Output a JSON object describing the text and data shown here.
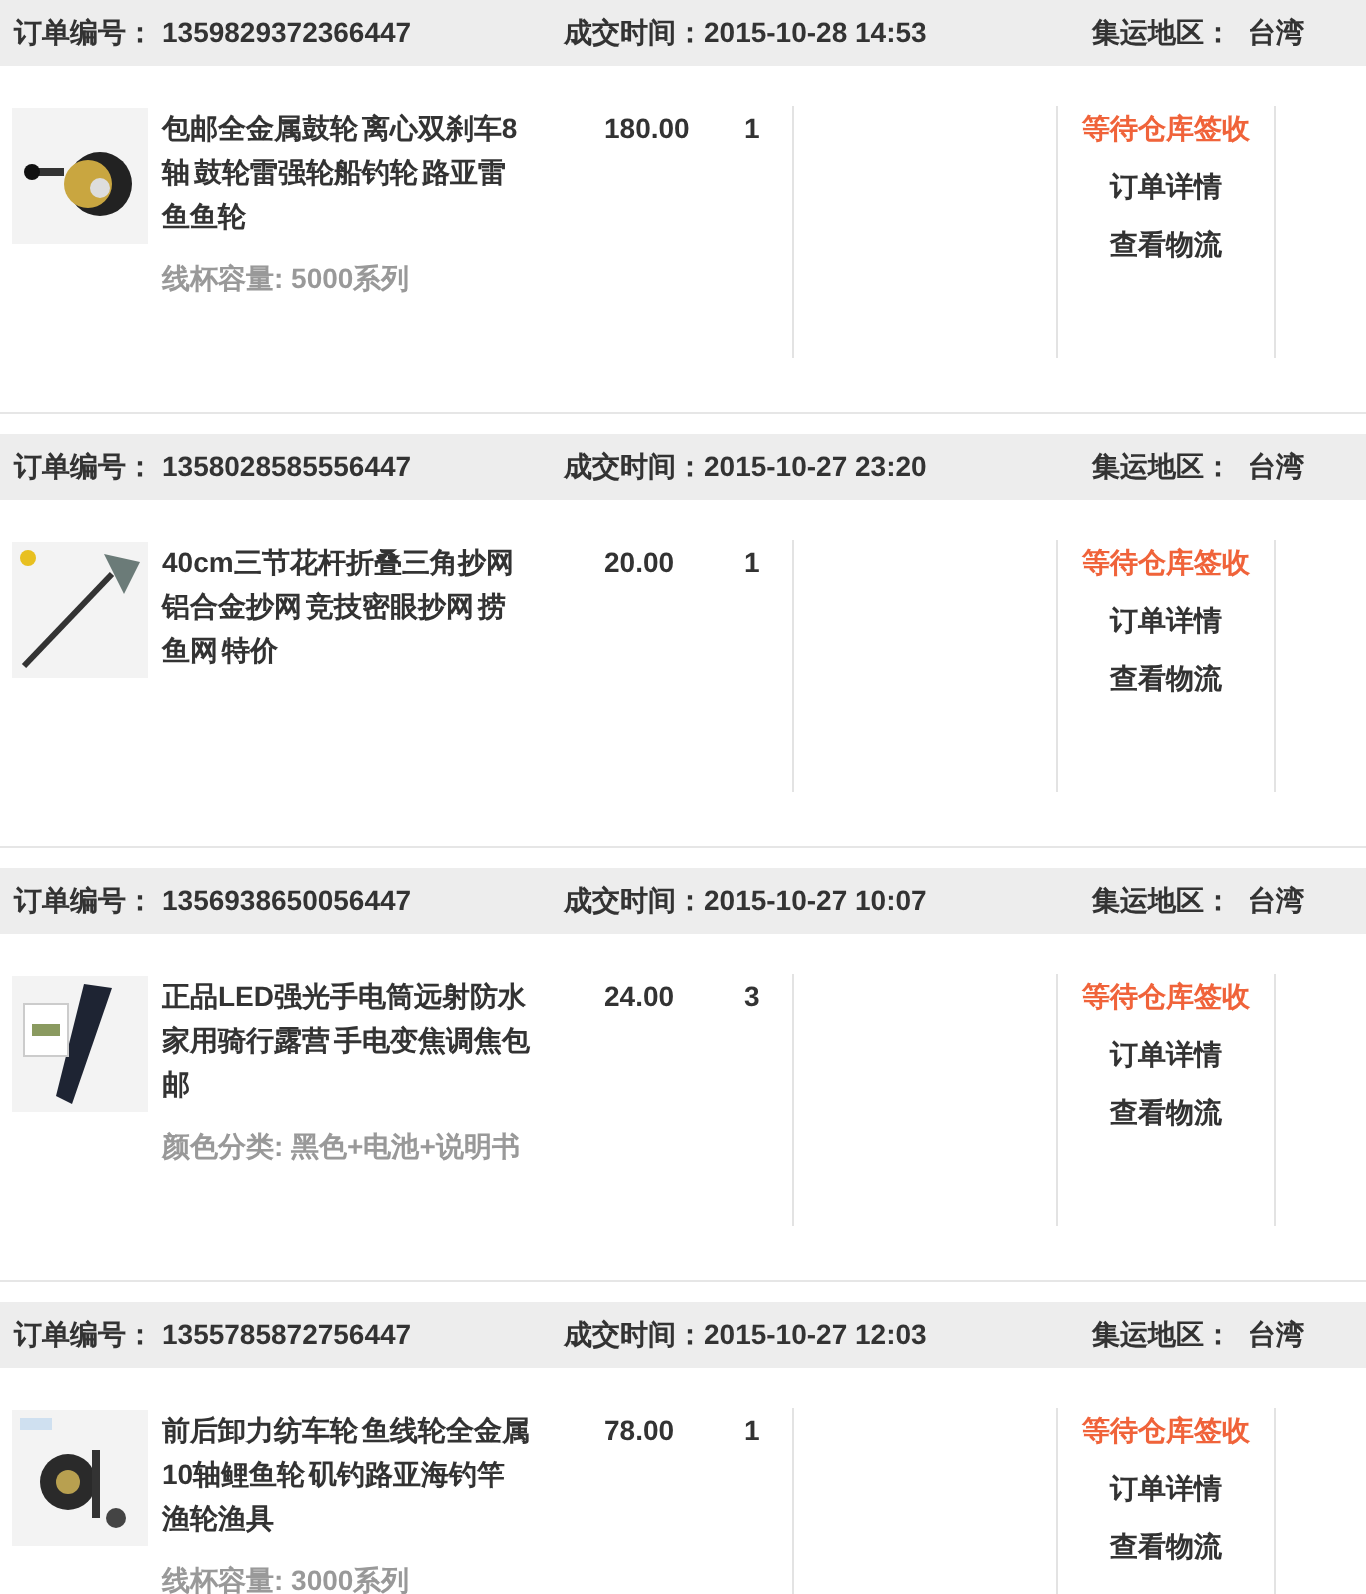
{
  "orders": [
    {
      "order_no_label": "订单编号：",
      "order_no": "1359829372366447",
      "time_label": "成交时间：",
      "time": "2015-10-28 14:53",
      "region_label": "集运地区：",
      "region": "台湾",
      "item": {
        "title": "包邮全金属鼓轮 离心双刹车8轴 鼓轮雷强轮船钓轮 路亚雷鱼鱼轮",
        "price": "180.00",
        "quantity": "1",
        "option": "线杯容量: 5000系列",
        "status": "等待仓库签收",
        "links": [
          "订单详情",
          "查看物流"
        ]
      }
    },
    {
      "order_no_label": "订单编号：",
      "order_no": "1358028585556447",
      "time_label": "成交时间：",
      "time": "2015-10-27 23:20",
      "region_label": "集运地区：",
      "region": "台湾",
      "item": {
        "title": "40cm三节花杆折叠三角抄网铝合金抄网 竞技密眼抄网 捞鱼网 特价",
        "price": "20.00",
        "quantity": "1",
        "status": "等待仓库签收",
        "links": [
          "订单详情",
          "查看物流"
        ]
      }
    },
    {
      "order_no_label": "订单编号：",
      "order_no": "1356938650056447",
      "time_label": "成交时间：",
      "time": "2015-10-27 10:07",
      "region_label": "集运地区：",
      "region": "台湾",
      "item": {
        "title": "正品LED强光手电筒远射防水家用骑行露营 手电变焦调焦包邮",
        "price": "24.00",
        "quantity": "3",
        "option": "颜色分类: 黑色+电池+说明书",
        "status": "等待仓库签收",
        "links": [
          "订单详情",
          "查看物流"
        ]
      }
    },
    {
      "order_no_label": "订单编号：",
      "order_no": "1355785872756447",
      "time_label": "成交时间：",
      "time": "2015-10-27 12:03",
      "region_label": "集运地区：",
      "region": "台湾",
      "item": {
        "title": "前后卸力纺车轮 鱼线轮全金属10轴鲤鱼轮 矶钓路亚海钓竿渔轮渔具",
        "price": "78.00",
        "quantity": "1",
        "option": "线杯容量: 3000系列",
        "status": "等待仓库签收",
        "links": [
          "订单详情",
          "查看物流"
        ]
      }
    }
  ]
}
